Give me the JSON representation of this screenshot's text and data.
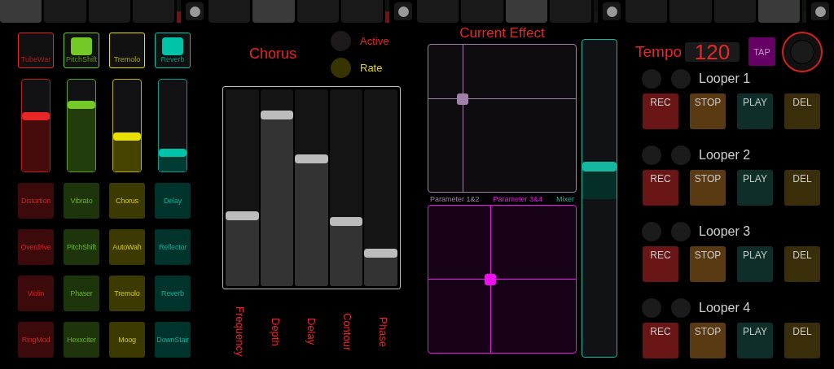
{
  "step_bar": {
    "groups": [
      {
        "pads": [
          {
            "selected": true
          },
          {
            "selected": false
          },
          {
            "selected": false
          },
          {
            "selected": false
          }
        ],
        "indicator": {
          "on": true
        }
      },
      {
        "pads": [
          {
            "selected": false
          },
          {
            "selected": true
          },
          {
            "selected": false
          },
          {
            "selected": false
          }
        ],
        "indicator": {
          "on": true
        }
      },
      {
        "pads": [
          {
            "selected": false
          },
          {
            "selected": false
          },
          {
            "selected": true
          },
          {
            "selected": false
          }
        ],
        "indicator": {
          "on": false
        }
      },
      {
        "pads": [
          {
            "selected": false
          },
          {
            "selected": false
          },
          {
            "selected": false
          },
          {
            "selected": true
          }
        ],
        "indicator": {
          "on": false
        }
      }
    ]
  },
  "channels": [
    {
      "name": "TubeWar",
      "color": "#e82626",
      "on": false,
      "level": 0.6,
      "effects": [
        "Distortion",
        "Overdrive",
        "Violin",
        "RingMod"
      ]
    },
    {
      "name": "PitchShift",
      "color": "#74c828",
      "on": true,
      "level": 0.73,
      "effects": [
        "Vibrato",
        "PitchShift",
        "Phaser",
        "Hexxciter"
      ]
    },
    {
      "name": "Tremolo",
      "color": "#e8e000",
      "on": false,
      "level": 0.38,
      "effects": [
        "Chorus",
        "AutoWah",
        "Tremolo",
        "Moog"
      ]
    },
    {
      "name": "Reverb",
      "color": "#00c4aa",
      "on": true,
      "level": 0.2,
      "effects": [
        "Delay",
        "Reflector",
        "Reverb",
        "DownStair"
      ]
    }
  ],
  "effect": {
    "title": "Chorus",
    "indicators": [
      {
        "label": "Active",
        "color": "#e82626",
        "on": false
      },
      {
        "label": "Rate",
        "color": "#e8d800",
        "on": true
      }
    ],
    "parameters": [
      {
        "label": "Frequency",
        "level": 0.36
      },
      {
        "label": "Depth",
        "level": 0.87
      },
      {
        "label": "Delay",
        "level": 0.65
      },
      {
        "label": "Contour",
        "level": 0.33
      },
      {
        "label": "Phase",
        "level": 0.17
      }
    ]
  },
  "current_effect": {
    "title": "Current Effect",
    "pads": [
      {
        "label": "Parameter 1&2",
        "color": "#a080a8",
        "horizontal": {
          "level": 0.23
        },
        "vertical": {
          "level": 0.63
        }
      },
      {
        "label": "Parameter 3&4",
        "color": "#f010f0",
        "horizontal": {
          "level": 0.42
        },
        "vertical": {
          "level": 0.5
        }
      }
    ],
    "mixer": {
      "label": "Mixer",
      "color": "#12b8a0",
      "level": 0.6
    }
  },
  "tempo": {
    "label": "Tempo",
    "value": "120",
    "tap": "TAP"
  },
  "loopers": [
    {
      "name": "Looper 1",
      "lights": [
        {
          "on": false
        },
        {
          "on": false
        }
      ],
      "buttons": [
        {
          "label": "REC",
          "kind": "rec"
        },
        {
          "label": "STOP",
          "kind": "stop"
        },
        {
          "label": "PLAY",
          "kind": "play"
        },
        {
          "label": "DEL",
          "kind": "del"
        }
      ]
    },
    {
      "name": "Looper 2",
      "lights": [
        {
          "on": false
        },
        {
          "on": false
        }
      ],
      "buttons": [
        {
          "label": "REC",
          "kind": "rec"
        },
        {
          "label": "STOP",
          "kind": "stop"
        },
        {
          "label": "PLAY",
          "kind": "play"
        },
        {
          "label": "DEL",
          "kind": "del"
        }
      ]
    },
    {
      "name": "Looper 3",
      "lights": [
        {
          "on": false
        },
        {
          "on": false
        }
      ],
      "buttons": [
        {
          "label": "REC",
          "kind": "rec"
        },
        {
          "label": "STOP",
          "kind": "stop"
        },
        {
          "label": "PLAY",
          "kind": "play"
        },
        {
          "label": "DEL",
          "kind": "del"
        }
      ]
    },
    {
      "name": "Looper 4",
      "lights": [
        {
          "on": false
        },
        {
          "on": false
        }
      ],
      "buttons": [
        {
          "label": "REC",
          "kind": "rec"
        },
        {
          "label": "STOP",
          "kind": "stop"
        },
        {
          "label": "PLAY",
          "kind": "play"
        },
        {
          "label": "DEL",
          "kind": "del"
        }
      ]
    }
  ]
}
